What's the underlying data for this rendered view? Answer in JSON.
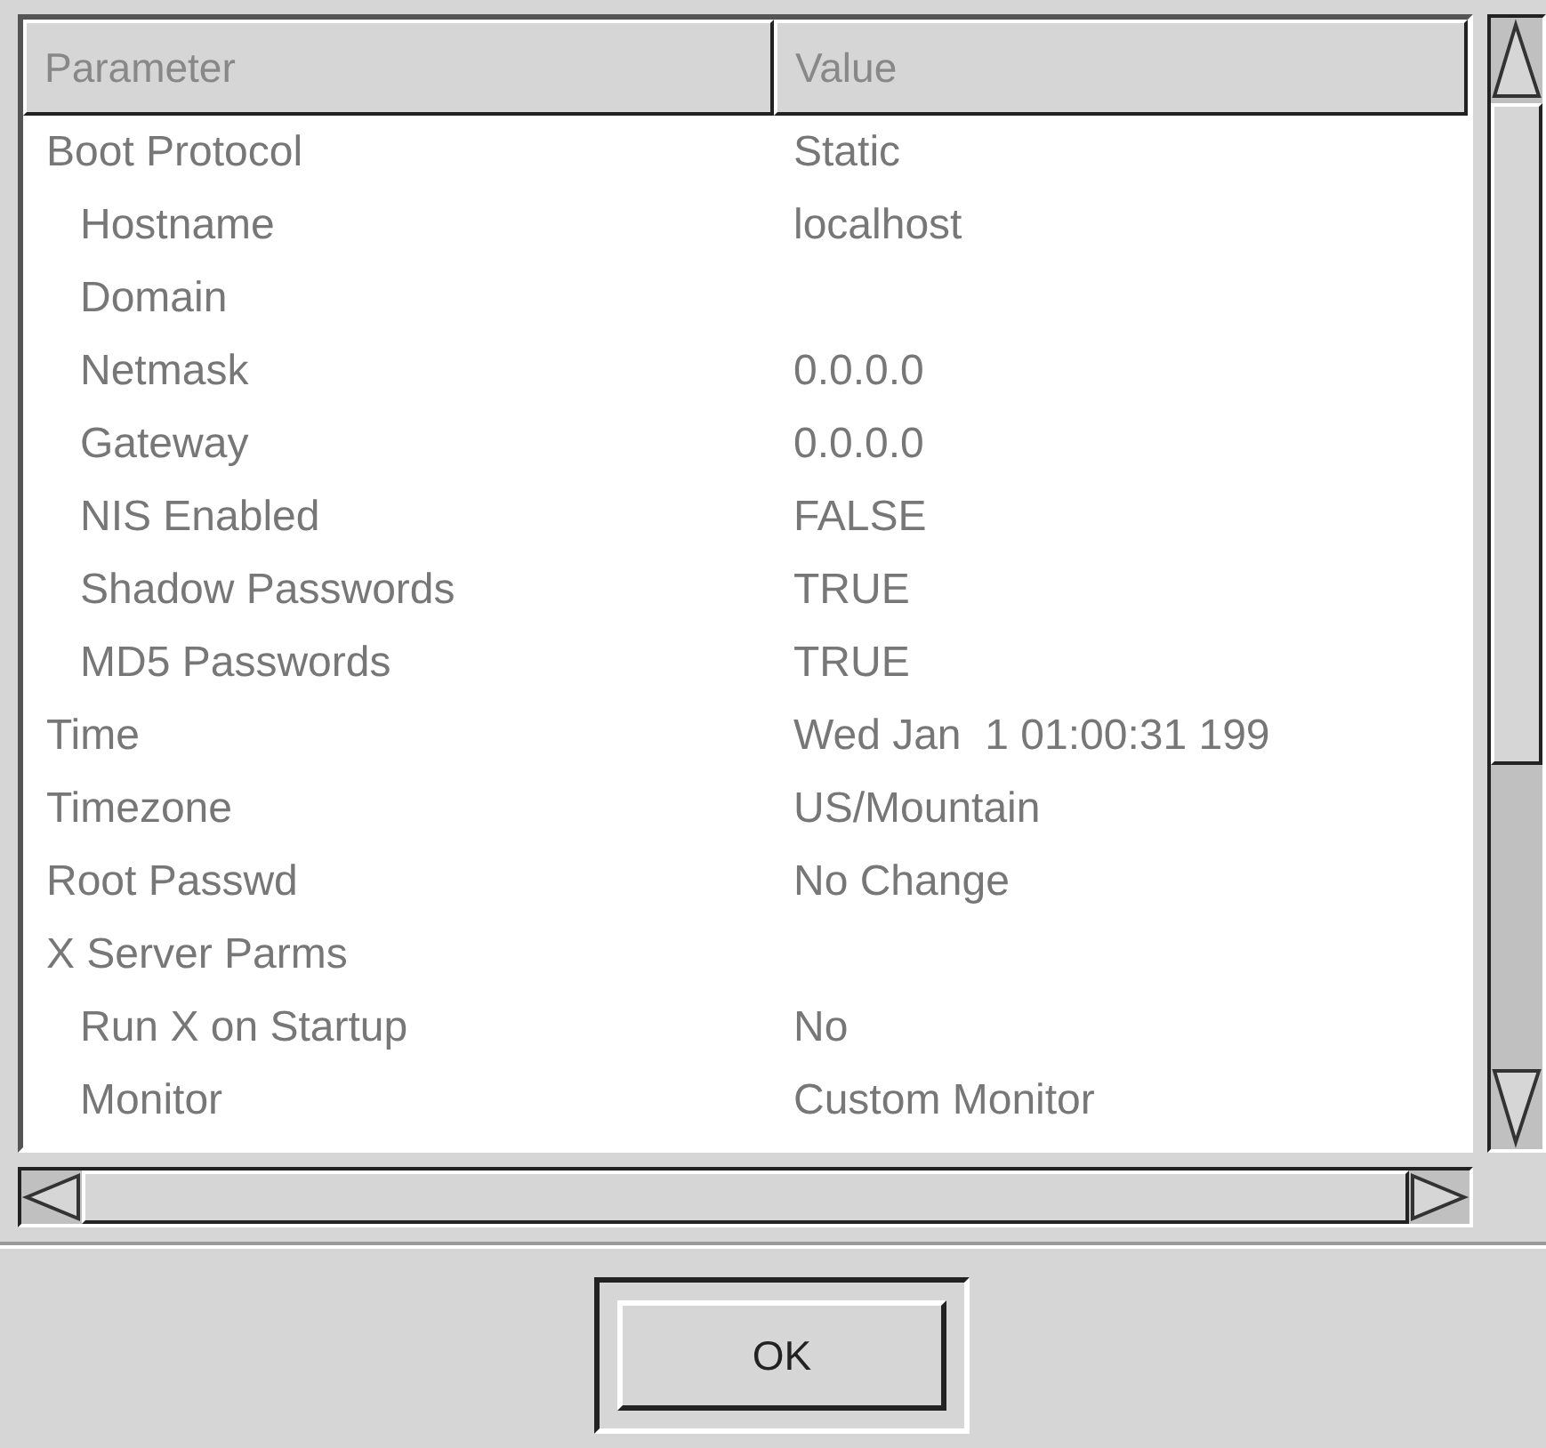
{
  "table": {
    "columns": [
      "Parameter",
      "Value"
    ],
    "rows": [
      {
        "parameter": "Boot Protocol",
        "value": "Static",
        "children": [
          {
            "parameter": "Hostname",
            "value": "localhost"
          },
          {
            "parameter": "Domain"
          },
          {
            "parameter": "Netmask",
            "value": "0.0.0.0"
          },
          {
            "parameter": "Gateway",
            "value": "0.0.0.0"
          },
          {
            "parameter": "NIS Enabled",
            "value": "FALSE"
          },
          {
            "parameter": "Shadow Passwords",
            "value": "TRUE"
          },
          {
            "parameter": "MD5 Passwords",
            "value": "TRUE"
          }
        ]
      },
      {
        "parameter": "Time",
        "value": "Wed Jan  1 01:00:31 199"
      },
      {
        "parameter": "Timezone",
        "value": "US/Mountain"
      },
      {
        "parameter": "Root Passwd",
        "value": "No Change"
      },
      {
        "parameter": "X Server Parms",
        "children": [
          {
            "parameter": "Run X on Startup",
            "value": "No"
          },
          {
            "parameter": "Monitor",
            "value": "Custom Monitor"
          }
        ]
      }
    ]
  },
  "buttons": [
    "OK"
  ]
}
